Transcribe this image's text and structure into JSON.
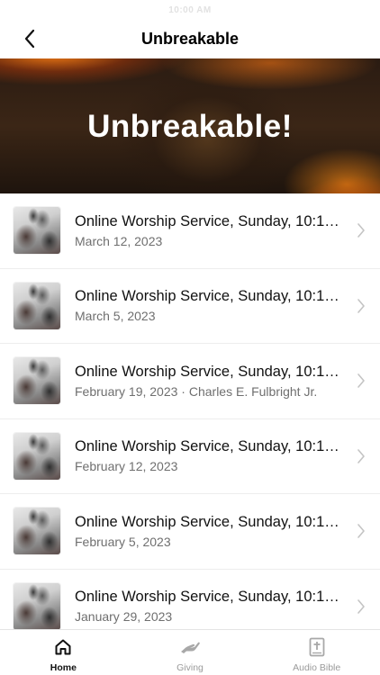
{
  "status_bar": {
    "time": "10:00 AM"
  },
  "header": {
    "title": "Unbreakable",
    "back_icon": "chevron-left-icon"
  },
  "banner": {
    "title": "Unbreakable!"
  },
  "sermons": [
    {
      "title": "Online Worship Service, Sunday, 10:1…",
      "subtitle": "March 12, 2023"
    },
    {
      "title": "Online Worship Service, Sunday, 10:1…",
      "subtitle": "March 5, 2023"
    },
    {
      "title": "Online Worship Service, Sunday, 10:1…",
      "subtitle": "February 19, 2023 · Charles E. Fulbright Jr."
    },
    {
      "title": "Online Worship Service, Sunday, 10:1…",
      "subtitle": "February 12, 2023"
    },
    {
      "title": "Online Worship Service, Sunday, 10:1…",
      "subtitle": "February 5, 2023"
    },
    {
      "title": "Online Worship Service, Sunday, 10:1…",
      "subtitle": "January 29, 2023"
    }
  ],
  "tabs": [
    {
      "label": "Home",
      "icon": "home-icon",
      "active": true
    },
    {
      "label": "Giving",
      "icon": "giving-hand-icon",
      "active": false
    },
    {
      "label": "Audio Bible",
      "icon": "bible-icon",
      "active": false
    }
  ],
  "colors": {
    "accent": "#111111",
    "inactive": "#9a9a9a",
    "subtitle": "#6f6f6f"
  }
}
